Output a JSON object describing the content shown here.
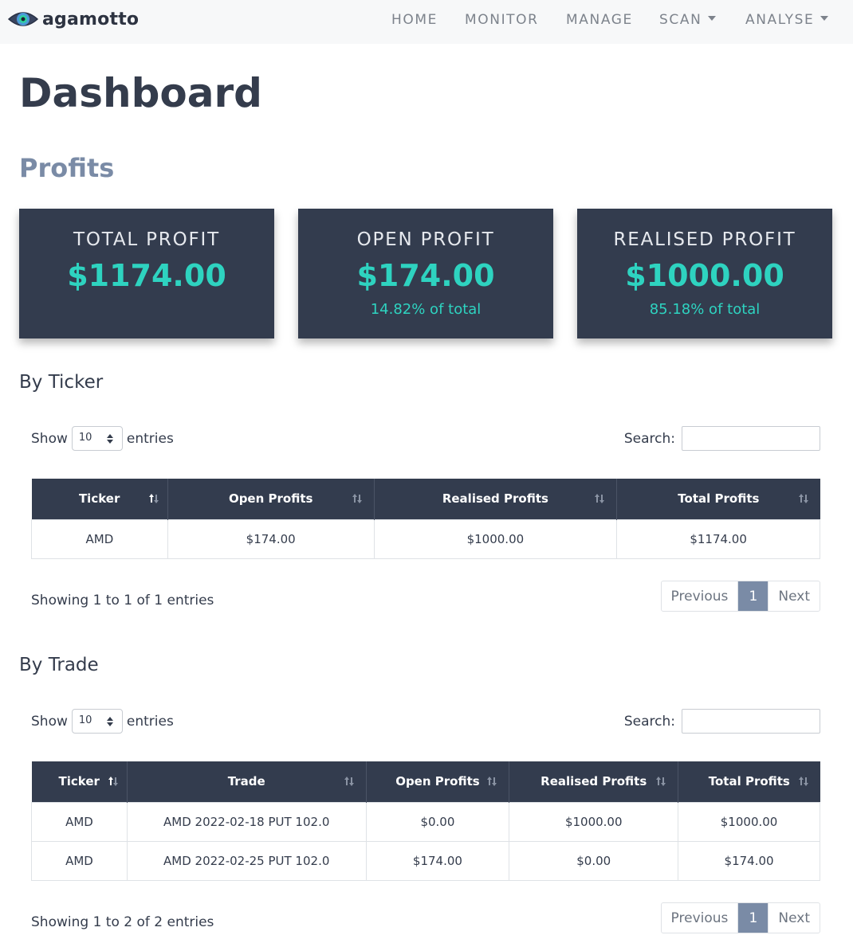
{
  "brand": {
    "name": "agamotto"
  },
  "nav": {
    "items": [
      {
        "label": "HOME"
      },
      {
        "label": "MONITOR"
      },
      {
        "label": "MANAGE"
      },
      {
        "label": "SCAN"
      },
      {
        "label": "ANALYSE"
      }
    ]
  },
  "page": {
    "title": "Dashboard",
    "section": "Profits"
  },
  "cards": [
    {
      "label": "TOTAL PROFIT",
      "value": "$1174.00",
      "pct": ""
    },
    {
      "label": "OPEN PROFIT",
      "value": "$174.00",
      "pct": "14.82% of total"
    },
    {
      "label": "REALISED PROFIT",
      "value": "$1000.00",
      "pct": "85.18% of total"
    }
  ],
  "by_ticker": {
    "title": "By Ticker",
    "show_label": "Show",
    "entries_label": "entries",
    "page_size": "10",
    "search_label": "Search:",
    "search_value": "",
    "columns": [
      "Ticker",
      "Open Profits",
      "Realised Profits",
      "Total Profits"
    ],
    "rows": [
      [
        "AMD",
        "$174.00",
        "$1000.00",
        "$1174.00"
      ]
    ],
    "info": "Showing 1 to 1 of 1 entries",
    "pager": {
      "prev": "Previous",
      "page": "1",
      "next": "Next"
    }
  },
  "by_trade": {
    "title": "By Trade",
    "show_label": "Show",
    "entries_label": "entries",
    "page_size": "10",
    "search_label": "Search:",
    "search_value": "",
    "columns": [
      "Ticker",
      "Trade",
      "Open Profits",
      "Realised Profits",
      "Total Profits"
    ],
    "rows": [
      [
        "AMD",
        "AMD 2022-02-18 PUT 102.0",
        "$0.00",
        "$1000.00",
        "$1000.00"
      ],
      [
        "AMD",
        "AMD 2022-02-25 PUT 102.0",
        "$174.00",
        "$0.00",
        "$174.00"
      ]
    ],
    "info": "Showing 1 to 2 of 2 entries",
    "pager": {
      "prev": "Previous",
      "page": "1",
      "next": "Next"
    }
  },
  "colors": {
    "card_bg": "#333c4e",
    "accent": "#2ed3c0",
    "section": "#7a8ba6",
    "active_page": "#7a8ba6"
  },
  "icons": {
    "logo": "eye-icon",
    "sort": "sort-arrows-icon",
    "select": "select-arrows-icon",
    "dropdown": "caret-down-icon"
  }
}
